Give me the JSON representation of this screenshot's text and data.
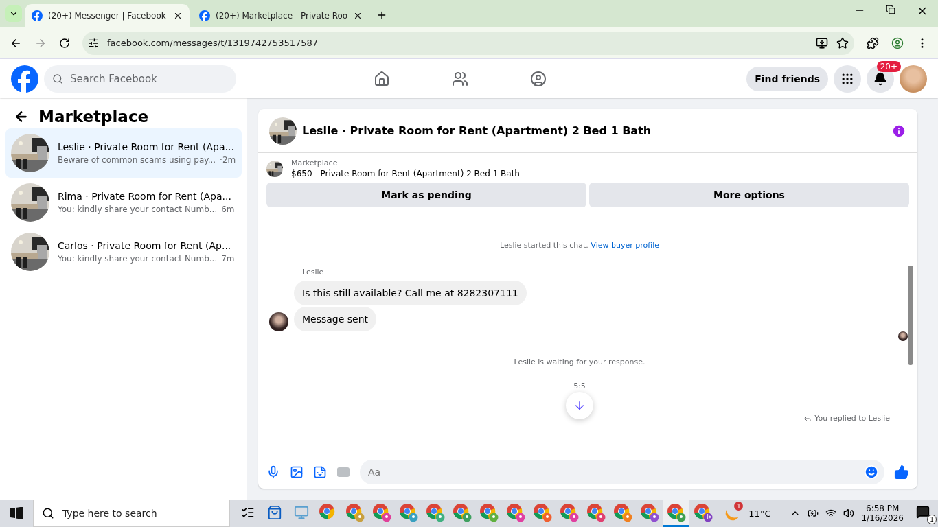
{
  "browser": {
    "tabs": [
      {
        "title": "(20+) Messenger | Facebook",
        "selected": true
      },
      {
        "title": "(20+) Marketplace - Private Roo",
        "selected": false
      }
    ],
    "url": "facebook.com/messages/t/1319742753517587"
  },
  "header": {
    "search_placeholder": "Search Facebook",
    "find_friends": "Find friends",
    "notification_badge": "20+"
  },
  "sidebar": {
    "title": "Marketplace",
    "conversations": [
      {
        "title": "Leslie · Private Room for Rent (Apa...",
        "preview": "Beware of common scams using pay...",
        "time": "·2m",
        "selected": true
      },
      {
        "title": "Rima · Private Room for Rent (Apa...",
        "preview": "You: kindly share your contact Numb...",
        "time": "6m",
        "selected": false
      },
      {
        "title": "Carlos · Private Room for Rent (Ap...",
        "preview": "You: kindly share your contact Numb...",
        "time": "7m",
        "selected": false
      }
    ]
  },
  "chat": {
    "title": "Leslie · Private Room for Rent (Apartment) 2 Bed 1 Bath",
    "listing": {
      "label": "Marketplace",
      "title": "$650 - Private Room for Rent (Apartment) 2 Bed 1 Bath"
    },
    "actions": [
      "Mark as pending",
      "More options"
    ],
    "started": {
      "text": "Leslie started this chat.",
      "link": "View buyer profile"
    },
    "sender": "Leslie",
    "messages": [
      "Is this still available? Call me at 8282307111",
      "Message sent"
    ],
    "waiting": "Leslie is waiting for your response.",
    "time": "5:5",
    "reply_note": "You replied to Leslie",
    "composer_placeholder": "Aa"
  },
  "taskbar": {
    "search_placeholder": "Type here to search",
    "apps": [
      {
        "kind": "taskview",
        "selected": false
      },
      {
        "kind": "store",
        "selected": false
      },
      {
        "kind": "pc",
        "selected": false
      },
      {
        "kind": "chrome",
        "selected": false
      },
      {
        "kind": "chrome",
        "color": "#c8a040",
        "selected": false
      },
      {
        "kind": "chrome",
        "color": "#e0409a",
        "selected": false
      },
      {
        "kind": "chrome",
        "color": "#3aa0c0",
        "selected": false
      },
      {
        "kind": "chrome",
        "color": "#40b080",
        "selected": false
      },
      {
        "kind": "chrome",
        "color": "#40a060",
        "selected": false
      },
      {
        "kind": "chrome",
        "color": "#60b040",
        "selected": false
      },
      {
        "kind": "chrome",
        "color": "#e040a0",
        "selected": false
      },
      {
        "kind": "chrome",
        "color": "#f06030",
        "selected": false
      },
      {
        "kind": "chrome",
        "color": "#e040a0",
        "selected": false
      },
      {
        "kind": "chrome",
        "color": "#e04070",
        "selected": false
      },
      {
        "kind": "chrome",
        "color": "#f08020",
        "selected": false
      },
      {
        "kind": "chrome",
        "color": "#9050d0",
        "selected": false
      },
      {
        "kind": "chrome",
        "color": "#40a050",
        "selected": true
      },
      {
        "kind": "chrome",
        "color": "#8040c0",
        "label": "Ix",
        "selected": false
      }
    ],
    "weather_badge": "1",
    "temperature": "11°C",
    "time": "6:58 PM",
    "date": "1/16/2026",
    "notification_count": "1"
  }
}
